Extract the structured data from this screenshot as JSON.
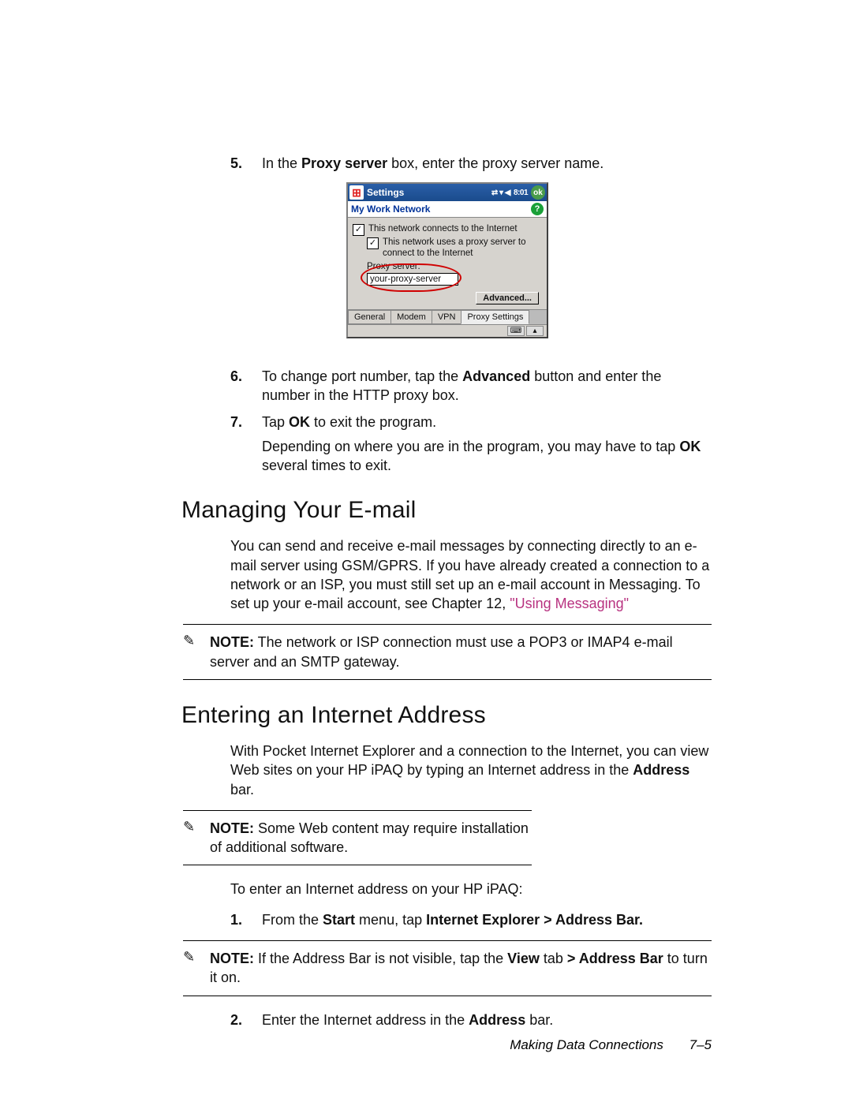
{
  "steps_top": {
    "item5": {
      "num": "5.",
      "pre": "In the ",
      "bold1": "Proxy server",
      "post": " box, enter the proxy server name."
    },
    "item6": {
      "num": "6.",
      "p1_pre": "To change port number, tap the ",
      "p1_bold": "Advanced",
      "p1_post": " button and enter the number in the HTTP proxy box."
    },
    "item7": {
      "num": "7.",
      "line1_pre": "Tap ",
      "line1_bold": "OK",
      "line1_post": " to exit the program.",
      "line2_pre": "Depending on where you are in the program, you may have to tap ",
      "line2_bold": "OK",
      "line2_post": " several times to exit."
    }
  },
  "screenshot": {
    "title": "Settings",
    "status": "8:01",
    "ok": "ok",
    "subheader": "My Work Network",
    "check1": "This network connects to the Internet",
    "check2": "This network uses a proxy server to connect to the Internet",
    "proxy_label": "Proxy server:",
    "proxy_value": "your-proxy-server",
    "advanced_btn": "Advanced...",
    "tabs": [
      "General",
      "Modem",
      "VPN",
      "Proxy Settings"
    ],
    "active_tab": 3
  },
  "section1": {
    "title": "Managing Your E-mail",
    "para_pre": "You can send and receive e-mail messages by connecting directly to an e-mail server using GSM/GPRS. If you have already created a connection to a network or an ISP, you must still set up an e-mail account in Messaging. To set up your e-mail account, see Chapter 12, ",
    "para_link": "\"Using Messaging\"",
    "note_label": "NOTE:",
    "note_text": " The network or ISP connection must use a POP3 or IMAP4 e-mail server and an SMTP gateway."
  },
  "section2": {
    "title": "Entering an Internet Address",
    "para1_pre": "With Pocket Internet Explorer and a connection to the Internet, you can view Web sites on your HP iPAQ by typing an Internet address in the ",
    "para1_bold": "Address",
    "para1_post": " bar.",
    "note1_label": "NOTE:",
    "note1_text": " Some Web content may require installation of additional software.",
    "para2": "To enter an Internet address on your HP iPAQ:",
    "step1": {
      "num": "1.",
      "pre": "From the ",
      "bold1": "Start",
      "mid": " menu, tap ",
      "bold2": "Internet Explorer > Address Bar."
    },
    "note2_label": "NOTE:",
    "note2_pre": " If the Address Bar is not visible, tap the ",
    "note2_b1": "View",
    "note2_mid": " tab ",
    "note2_b2": "> Address Bar",
    "note2_post": " to turn it on.",
    "step2": {
      "num": "2.",
      "pre": "Enter the Internet address in the ",
      "bold": "Address",
      "post": " bar."
    }
  },
  "footer": {
    "chapter": "Making Data Connections",
    "page": "7–5"
  }
}
